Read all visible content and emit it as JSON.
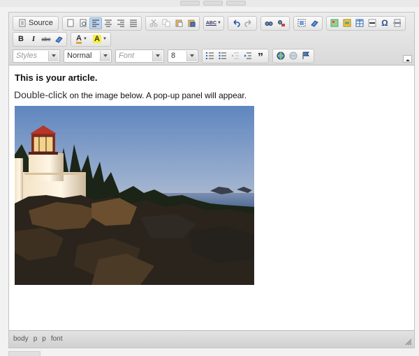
{
  "toolbar": {
    "source_label": "Source",
    "bold_label": "B",
    "italic_label": "I",
    "strike_label": "abc",
    "text_color_label": "A",
    "bg_color_label": "A",
    "spell_label": "ABC",
    "quote_label": "”",
    "special_char_label": "Ω"
  },
  "combos": {
    "styles": {
      "placeholder": "Styles"
    },
    "format": {
      "value": "Normal"
    },
    "font": {
      "placeholder": "Font"
    },
    "size": {
      "value": "8"
    }
  },
  "content": {
    "heading": "This is your article.",
    "lead_word": "Double-click",
    "rest_text": " on the image below. A pop-up panel will appear."
  },
  "status": {
    "path": [
      "body",
      "p",
      "p",
      "font"
    ]
  },
  "colors": {
    "accent": "#bcd4ee",
    "toolbar_bg": "#e2e2e2",
    "content_bg": "#ffffff"
  },
  "icons": [
    "source-icon",
    "new-page-icon",
    "preview-icon",
    "align-left-icon",
    "align-center-icon",
    "align-right-icon",
    "justify-icon",
    "cut-icon",
    "copy-icon",
    "paste-icon",
    "paste-word-icon",
    "spellcheck-icon",
    "undo-icon",
    "redo-icon",
    "find-icon",
    "replace-icon",
    "select-all-icon",
    "remove-format-icon",
    "image-icon",
    "flash-icon",
    "table-icon",
    "hr-icon",
    "special-char-icon",
    "page-break-icon",
    "remove-format-eraser-icon",
    "numbered-list-icon",
    "bulleted-list-icon",
    "outdent-icon",
    "indent-icon",
    "blockquote-icon",
    "link-icon",
    "unlink-icon",
    "anchor-icon"
  ]
}
